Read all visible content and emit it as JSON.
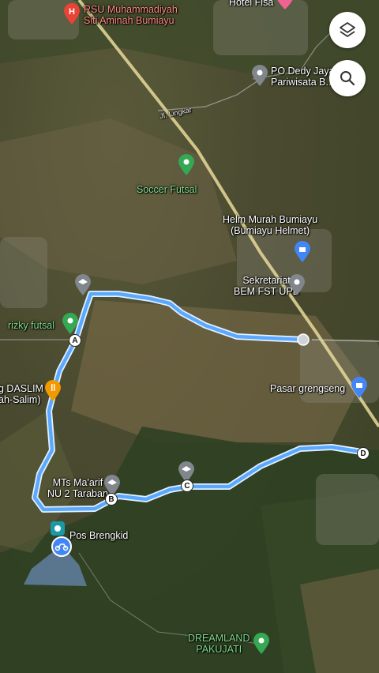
{
  "map": {
    "places": {
      "rsu": "RSU Muhammadiyah\nSiti Aminah Bumiayu",
      "hotel": "Hotel Fisa",
      "po_dedy": "PO Dedy Jaya\nPariwisata B...",
      "jl_lingkar": "Jl. Lingkar",
      "soccer_futsal": "Soccer Futsal",
      "helm_murah": "Helm Murah Bumiayu\n(Bumiayu Helmet)",
      "sekretariat": "Sekretariat\nBEM FST UPB",
      "rizky_futsal": "rizky futsal",
      "daslim": "g DASLIM\nah-Salim)",
      "pasar": "Pasar grengseng",
      "mts": "MTs Ma'arif\nNU 2 Taraban",
      "pos_brengkid": "Pos Brengkid",
      "dreamland": "DREAMLAND\nPAKUJATI"
    },
    "waypoints": {
      "a": "A",
      "b": "B",
      "c": "C",
      "d": "D"
    },
    "colors": {
      "route": "#5aa9ff",
      "route_border": "#d6ecff",
      "green_pin": "#34a853",
      "red_pin": "#ea4335",
      "blue_pin": "#4285f4",
      "grey_pin": "#80868b"
    }
  },
  "controls": {
    "layers_icon": "layers-icon",
    "search_icon": "search-icon"
  }
}
